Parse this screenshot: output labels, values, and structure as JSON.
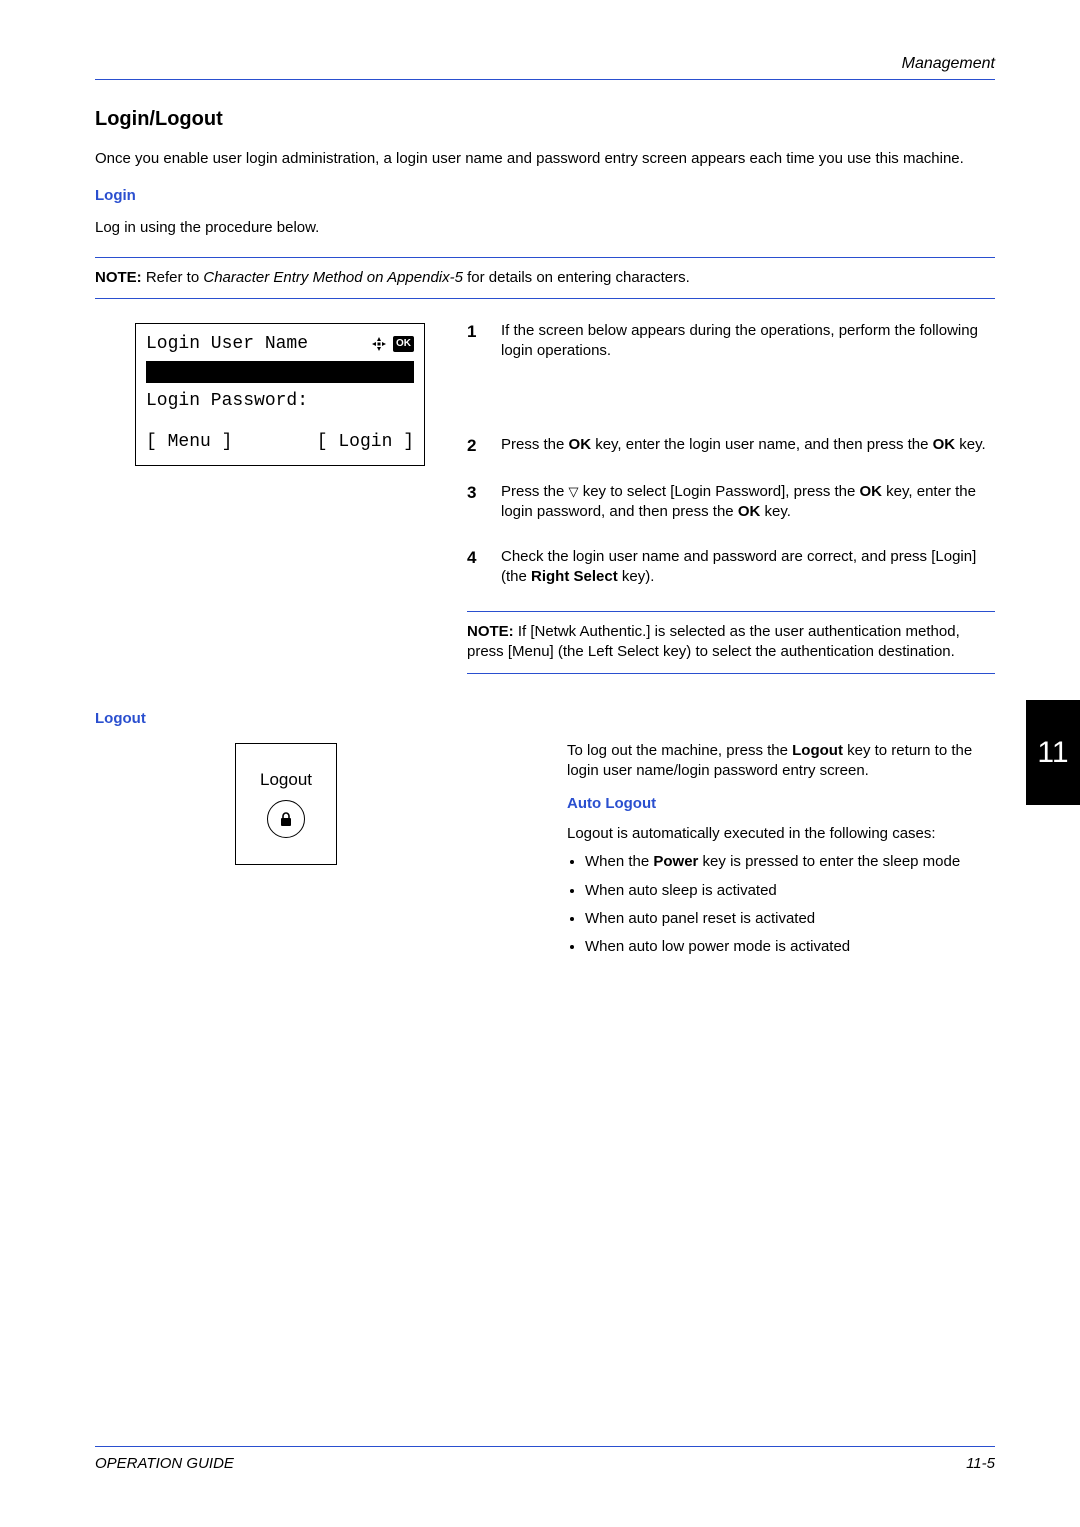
{
  "header": {
    "section": "Management"
  },
  "title": "Login/Logout",
  "intro": "Once you enable user login administration, a login user name and password entry screen appears each time you use this machine.",
  "login": {
    "heading": "Login",
    "lead": "Log in using the procedure below.",
    "note_label": "NOTE:",
    "note_pre": " Refer to ",
    "note_ital": "Character Entry Method on Appendix-5",
    "note_post": " for details on entering characters."
  },
  "lcd": {
    "line1": "Login User Name",
    "line2": "Login Password:",
    "menu": "[ Menu  ]",
    "login": "[ Login  ]",
    "ok": "OK"
  },
  "steps": {
    "s1": {
      "n": "1",
      "text": "If the screen below appears during the operations, perform the following login operations."
    },
    "s2": {
      "n": "2",
      "pre": "Press the ",
      "ok1": "OK",
      "mid": " key, enter the login user name, and then press the ",
      "ok2": "OK",
      "post": " key."
    },
    "s3": {
      "n": "3",
      "pre": "Press the ",
      "tri": "▽",
      "mid1": " key to select [Login Password], press the ",
      "ok1": "OK",
      "mid2": " key, enter the login password, and then press the ",
      "ok2": "OK",
      "post": " key."
    },
    "s4": {
      "n": "4",
      "pre": "Check the login user name and password are correct, and press [Login] (the ",
      "bold": "Right Select",
      "post": " key)."
    }
  },
  "inner_note": {
    "label": "NOTE:",
    "pre": " If [Netwk Authentic.] is selected as the user authentication method, press [Menu] (the ",
    "bold": "Left Select",
    "post": " key) to select the authentication destination."
  },
  "logout": {
    "heading": "Logout",
    "key_label": "Logout",
    "text_pre": "To log out the machine, press the ",
    "text_bold": "Logout",
    "text_post": " key to return to the login user name/login password entry screen.",
    "auto_heading": "Auto Logout",
    "auto_lead": "Logout is automatically executed in the following cases:",
    "bullets": {
      "b1_pre": "When the ",
      "b1_bold": "Power",
      "b1_post": " key is pressed to enter the sleep mode",
      "b2": "When auto sleep is activated",
      "b3": "When auto panel reset is activated",
      "b4": "When auto low power mode is activated"
    }
  },
  "chapter": "11",
  "footer": {
    "left": "OPERATION GUIDE",
    "right": "11-5"
  }
}
